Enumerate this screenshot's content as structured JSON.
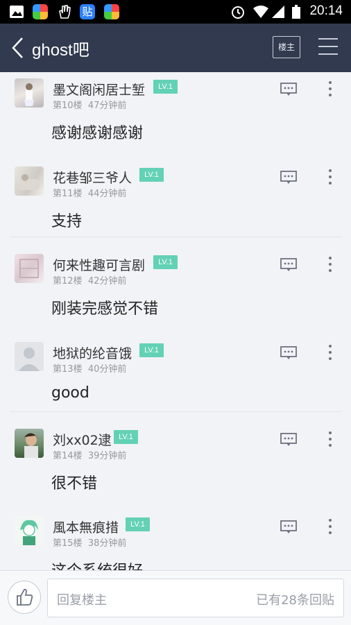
{
  "status_bar": {
    "time": "20:14"
  },
  "header": {
    "title": "ghost吧",
    "louzhu_label": "楼主"
  },
  "posts": [
    {
      "username": "墨文阁闲居士堑",
      "level": "LV.1",
      "floor": "第10楼",
      "time": "47分钟前",
      "content": "感谢感谢感谢"
    },
    {
      "username": "花巷邹三爷人",
      "level": "LV.1",
      "floor": "第11楼",
      "time": "44分钟前",
      "content": "支持"
    },
    {
      "username": "何来性趣可言剧",
      "level": "LV.1",
      "floor": "第12楼",
      "time": "42分钟前",
      "content": "刚装完感觉不错"
    },
    {
      "username": "地狱的纶音饿",
      "level": "LV.1",
      "floor": "第13楼",
      "time": "40分钟前",
      "content": "good"
    },
    {
      "username": "刘xx02逮",
      "level": "LV.1",
      "floor": "第14楼",
      "time": "39分钟前",
      "content": "很不错"
    },
    {
      "username": "風本無痕措",
      "level": "LV.1",
      "floor": "第15楼",
      "time": "38分钟前",
      "content": "这个系统很好"
    }
  ],
  "bottom_bar": {
    "reply_placeholder": "回复楼主",
    "reply_count": "已有28条回贴"
  },
  "colors": {
    "header_bg": "#313a4f",
    "level_badge": "#63d1b5",
    "page_bg": "#f1f3f6"
  }
}
